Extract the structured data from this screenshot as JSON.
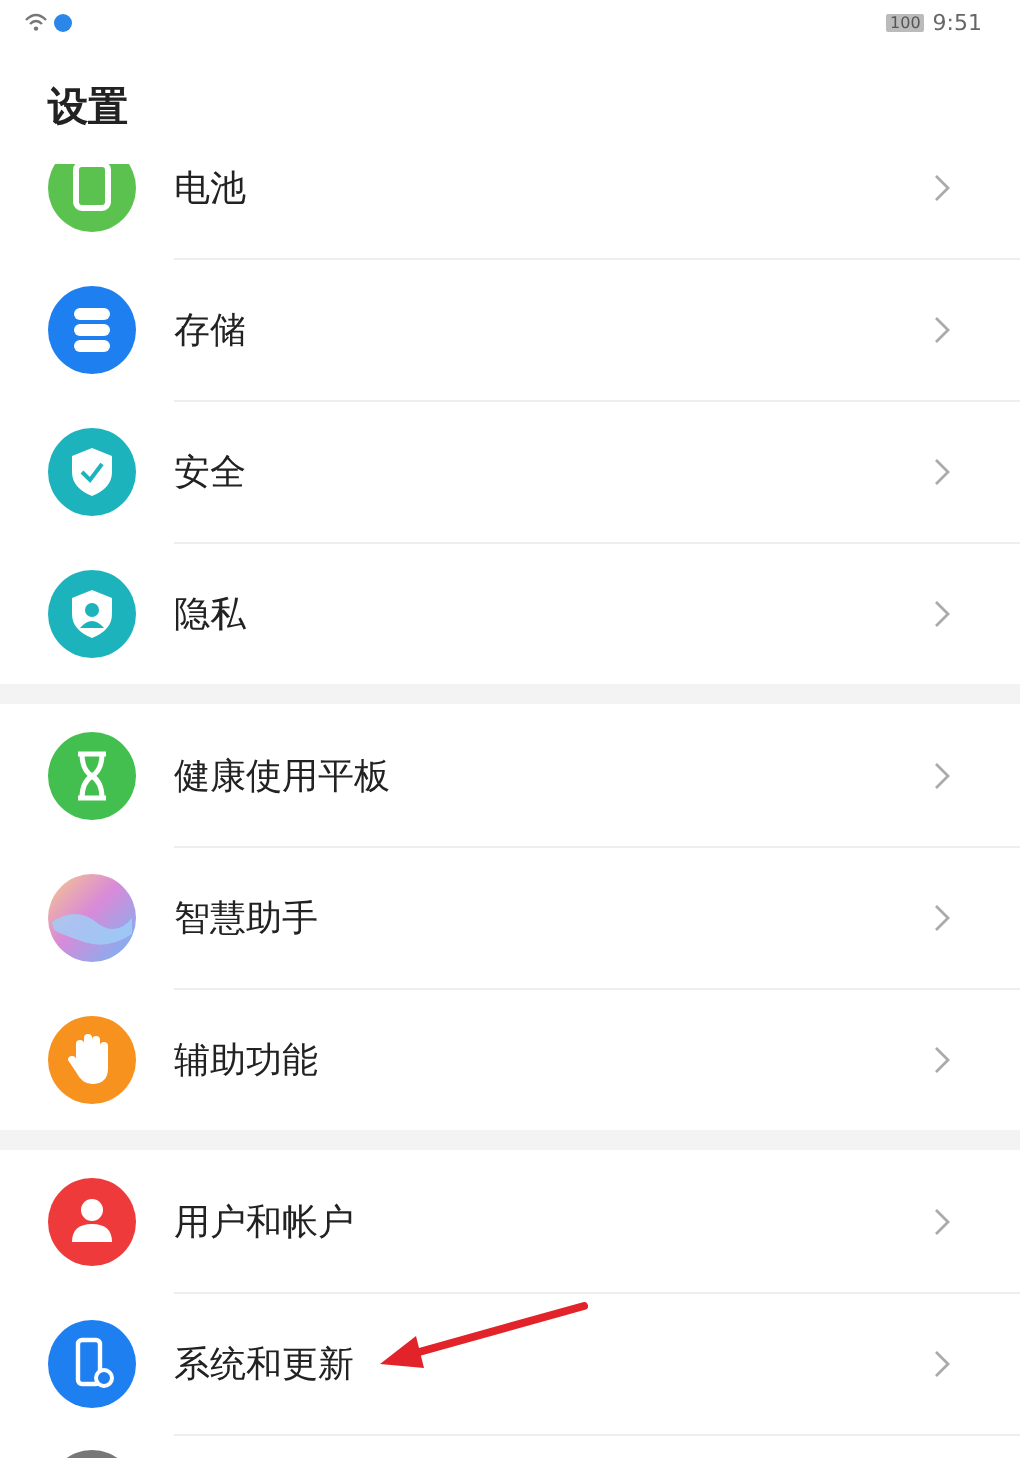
{
  "status_bar": {
    "battery": "100",
    "time": "9:51"
  },
  "title": "设置",
  "groups": [
    {
      "items": [
        {
          "kind": "battery",
          "label": "电池"
        },
        {
          "kind": "storage",
          "label": "存储"
        },
        {
          "kind": "security",
          "label": "安全"
        },
        {
          "kind": "privacy",
          "label": "隐私"
        }
      ]
    },
    {
      "items": [
        {
          "kind": "hourglass",
          "label": "健康使用平板"
        },
        {
          "kind": "assistant",
          "label": "智慧助手"
        },
        {
          "kind": "hand",
          "label": "辅助功能"
        }
      ]
    },
    {
      "items": [
        {
          "kind": "user",
          "label": "用户和帐户"
        },
        {
          "kind": "system",
          "label": "系统和更新"
        },
        {
          "kind": "gray"
        }
      ]
    }
  ]
}
